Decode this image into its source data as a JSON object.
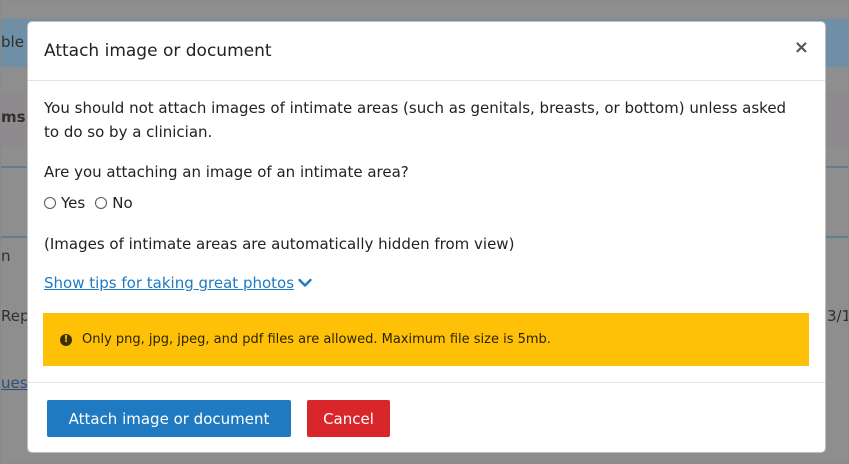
{
  "background": {
    "fragments": [
      "ble",
      "ms",
      "n",
      "Rep",
      "ues",
      "3/1"
    ]
  },
  "modal": {
    "title": "Attach image or document",
    "close_label": "×",
    "warning_text": "You should not attach images of intimate areas (such as genitals, breasts, or bottom) unless asked to do so by a clinician.",
    "question": "Are you attaching an image of an intimate area?",
    "options": [
      "Yes",
      "No"
    ],
    "note": "(Images of intimate areas are automatically hidden from view)",
    "tips_link": "Show tips for taking great photos",
    "alert_icon": "!",
    "alert_text": "Only png, jpg, jpeg, and pdf files are allowed. Maximum file size is 5mb.",
    "attach_button": "Attach image or document",
    "cancel_button": "Cancel"
  },
  "colors": {
    "primary": "#1f7ac1",
    "danger": "#d9262b",
    "alert": "#ffc107"
  },
  "icons": {
    "close": "close-icon",
    "chevron": "chevron-down-icon",
    "alert": "exclamation-circle-icon"
  }
}
